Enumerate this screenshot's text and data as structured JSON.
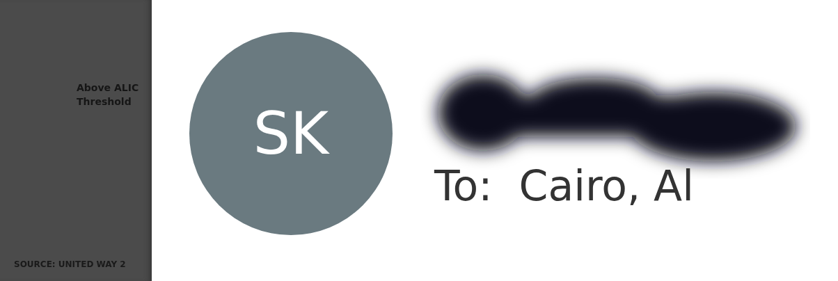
{
  "background_panel": {
    "legend_lines": [
      "Above ALIC",
      "Threshold"
    ],
    "source": "SOURCE: UNITED WAY 2"
  },
  "email_header": {
    "avatar_initials": "SK",
    "recipient_label": "To:",
    "recipient": "Cairo, Al"
  }
}
